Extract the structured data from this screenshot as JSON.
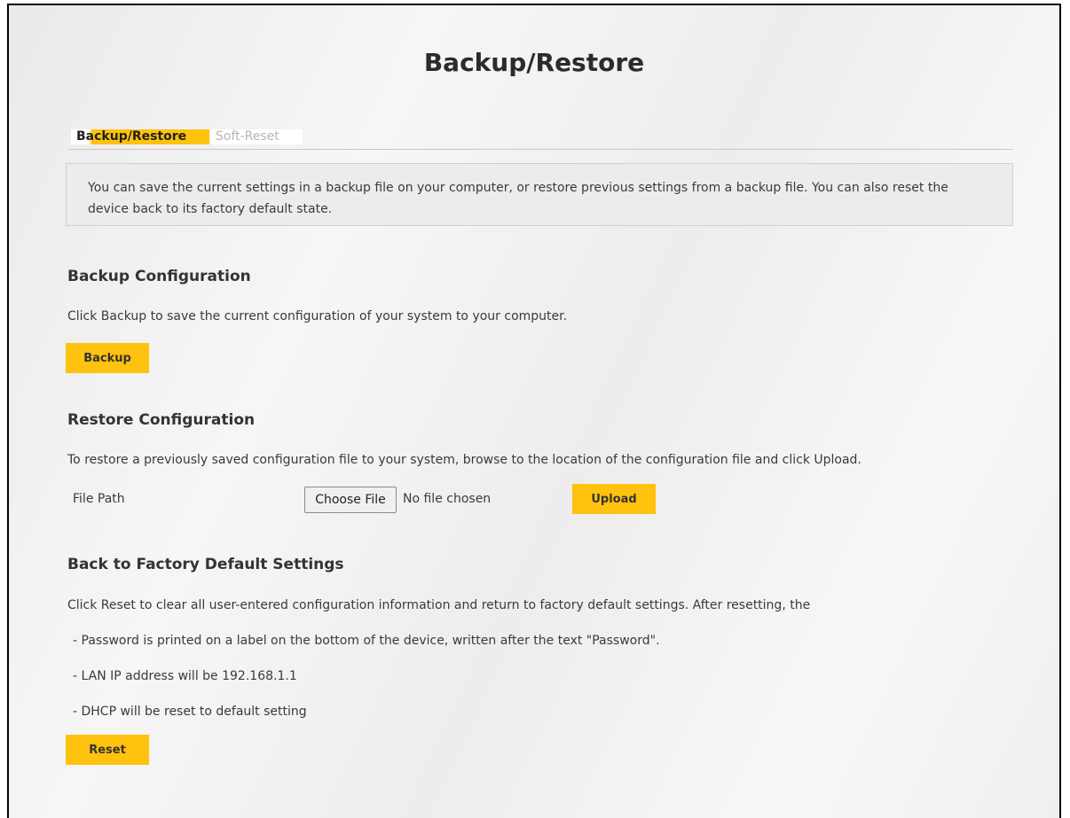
{
  "page_title": "Backup/Restore",
  "tabs": [
    {
      "label": "Backup/Restore",
      "active": true
    },
    {
      "label": "Soft-Reset",
      "active": false
    }
  ],
  "info": "You can save the current settings in a backup file on your computer, or restore previous settings from a backup file. You can also reset the device back to its factory default state.",
  "backup": {
    "title": "Backup Configuration",
    "description": "Click Backup to save the current configuration of your system to your computer.",
    "button_label": "Backup"
  },
  "restore": {
    "title": "Restore Configuration",
    "description": "To restore a previously saved configuration file to your system, browse to the location of the configuration file and click Upload.",
    "file_path_label": "File Path",
    "choose_file_label": "Choose File",
    "file_status": "No file chosen",
    "upload_label": "Upload"
  },
  "factory": {
    "title": "Back to Factory Default Settings",
    "description": "Click Reset to clear all user-entered configuration information and return to factory default settings. After resetting, the",
    "bullets": [
      "- Password is printed on a label on the bottom of the device, written after the text \"Password\".",
      "- LAN IP address will be 192.168.1.1",
      "- DHCP will be reset to default setting"
    ],
    "reset_label": "Reset"
  },
  "colors": {
    "accent": "#ffc20e",
    "info_bg": "#ececec",
    "inactive_tab_text": "#b5b5b5"
  }
}
